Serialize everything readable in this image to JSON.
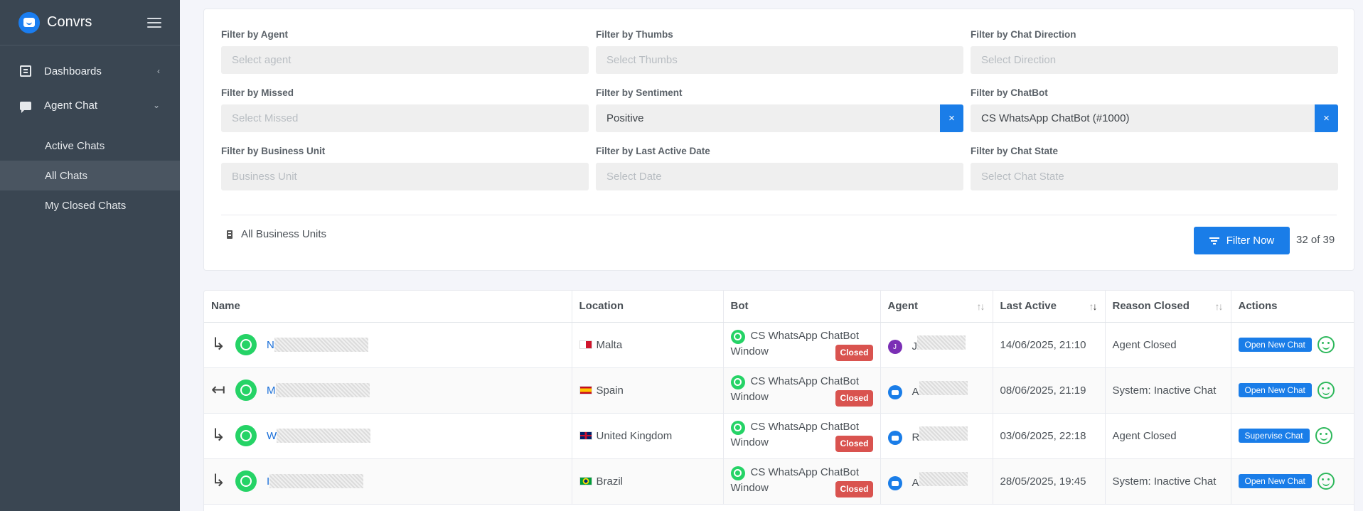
{
  "brand": {
    "name": "Convrs"
  },
  "sidebar": {
    "items": [
      {
        "label": "Dashboards",
        "icon": "dashboard-icon",
        "chevron": "‹"
      },
      {
        "label": "Agent Chat",
        "icon": "chat-icon",
        "chevron": "⌄"
      }
    ],
    "sub_items": [
      {
        "label": "Active Chats",
        "active": false
      },
      {
        "label": "All Chats",
        "active": true
      },
      {
        "label": "My Closed Chats",
        "active": false
      }
    ]
  },
  "filters": {
    "agent": {
      "label": "Filter by Agent",
      "placeholder": "Select agent"
    },
    "thumbs": {
      "label": "Filter by Thumbs",
      "placeholder": "Select Thumbs"
    },
    "direction": {
      "label": "Filter by Chat Direction",
      "placeholder": "Select Direction"
    },
    "missed": {
      "label": "Filter by Missed",
      "placeholder": "Select Missed"
    },
    "sentiment": {
      "label": "Filter by Sentiment",
      "value": "Positive",
      "clear": "×"
    },
    "chatbot": {
      "label": "Filter by ChatBot",
      "value": "CS WhatsApp ChatBot (#1000)",
      "clear": "×"
    },
    "business_unit": {
      "label": "Filter by Business Unit",
      "placeholder": "Business Unit"
    },
    "last_active": {
      "label": "Filter by Last Active Date",
      "placeholder": "Select Date"
    },
    "chat_state": {
      "label": "Filter by Chat State",
      "placeholder": "Select Chat State"
    },
    "all_business_units": "All Business Units",
    "filter_button": "Filter Now",
    "count": "32 of 39"
  },
  "table": {
    "headers": [
      "Name",
      "Location",
      "Bot",
      "Agent",
      "Last Active",
      "Reason Closed",
      "Actions"
    ],
    "rows": [
      {
        "direction": "↳",
        "initial": "N",
        "location": "Malta",
        "bot_line1": "CS WhatsApp ChatBot",
        "bot_line2": "Window",
        "status": "Closed",
        "agent_initial": "J",
        "agent_letter": "J",
        "last_active": "14/06/2025, 21:10",
        "reason": "Agent Closed",
        "action": "Open New Chat"
      },
      {
        "direction": "↤",
        "initial": "M",
        "location": "Spain",
        "bot_line1": "CS WhatsApp ChatBot",
        "bot_line2": "Window",
        "status": "Closed",
        "agent_initial": "",
        "agent_letter": "A",
        "last_active": "08/06/2025, 21:19",
        "reason": "System: Inactive Chat",
        "action": "Open New Chat"
      },
      {
        "direction": "↳",
        "initial": "W",
        "location": "United Kingdom",
        "bot_line1": "CS WhatsApp ChatBot",
        "bot_line2": "Window",
        "status": "Closed",
        "agent_initial": "",
        "agent_letter": "R",
        "last_active": "03/06/2025, 22:18",
        "reason": "Agent Closed",
        "action": "Supervise Chat"
      },
      {
        "direction": "↳",
        "initial": "I",
        "location": "Brazil",
        "bot_line1": "CS WhatsApp ChatBot",
        "bot_line2": "Window",
        "status": "Closed",
        "agent_initial": "",
        "agent_letter": "A",
        "last_active": "28/05/2025, 19:45",
        "reason": "System: Inactive Chat",
        "action": "Open New Chat"
      }
    ]
  },
  "colors": {
    "accent": "#1a7de8",
    "sidebar": "#3a4652",
    "closed_badge": "#d9534f",
    "whatsapp": "#25d366"
  }
}
